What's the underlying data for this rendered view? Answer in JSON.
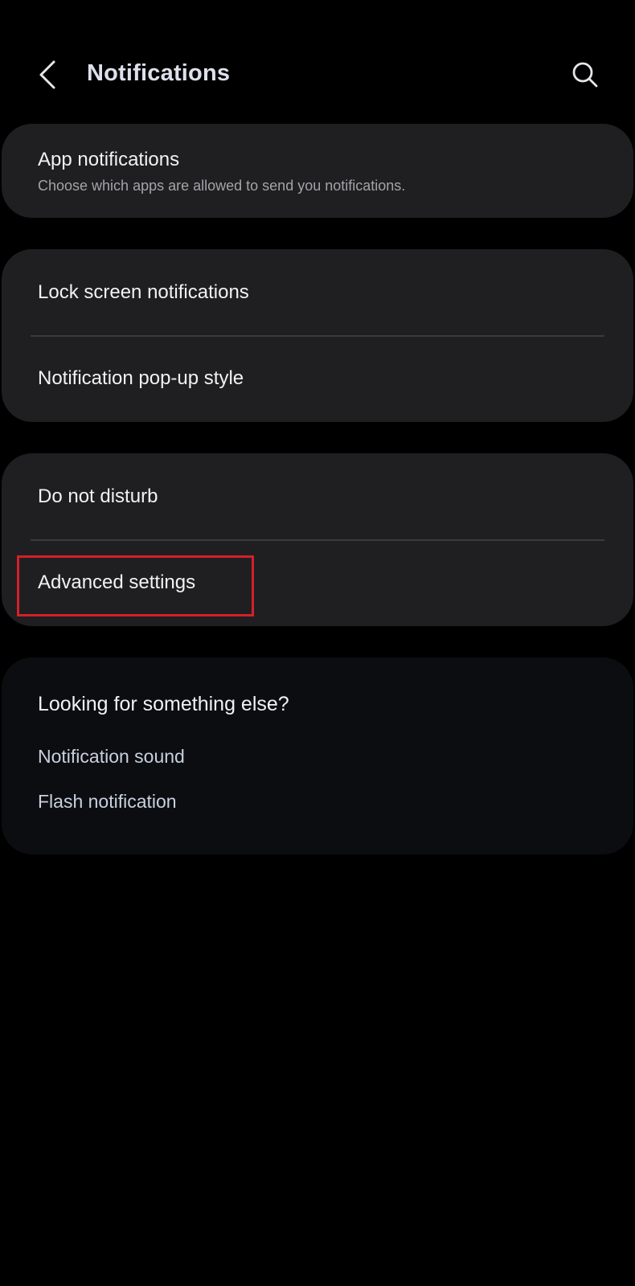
{
  "header": {
    "title": "Notifications",
    "back_icon": "chevron-left-icon",
    "search_icon": "search-icon"
  },
  "app_notifications": {
    "label": "App notifications",
    "subtitle": "Choose which apps are allowed to send you notifications."
  },
  "group_lock": {
    "items": [
      {
        "label": "Lock screen notifications"
      },
      {
        "label": "Notification pop-up style"
      }
    ]
  },
  "group_dnd": {
    "items": [
      {
        "label": "Do not disturb"
      },
      {
        "label": "Advanced settings",
        "highlighted": true
      }
    ]
  },
  "looking_for": {
    "title": "Looking for something else?",
    "links": [
      {
        "label": "Notification sound"
      },
      {
        "label": "Flash notification"
      }
    ]
  },
  "colors": {
    "background": "#000000",
    "card": "#1f1f21",
    "suggestion_card": "#0c0d10",
    "highlight": "#d4202a",
    "link": "#c8d0e0"
  }
}
